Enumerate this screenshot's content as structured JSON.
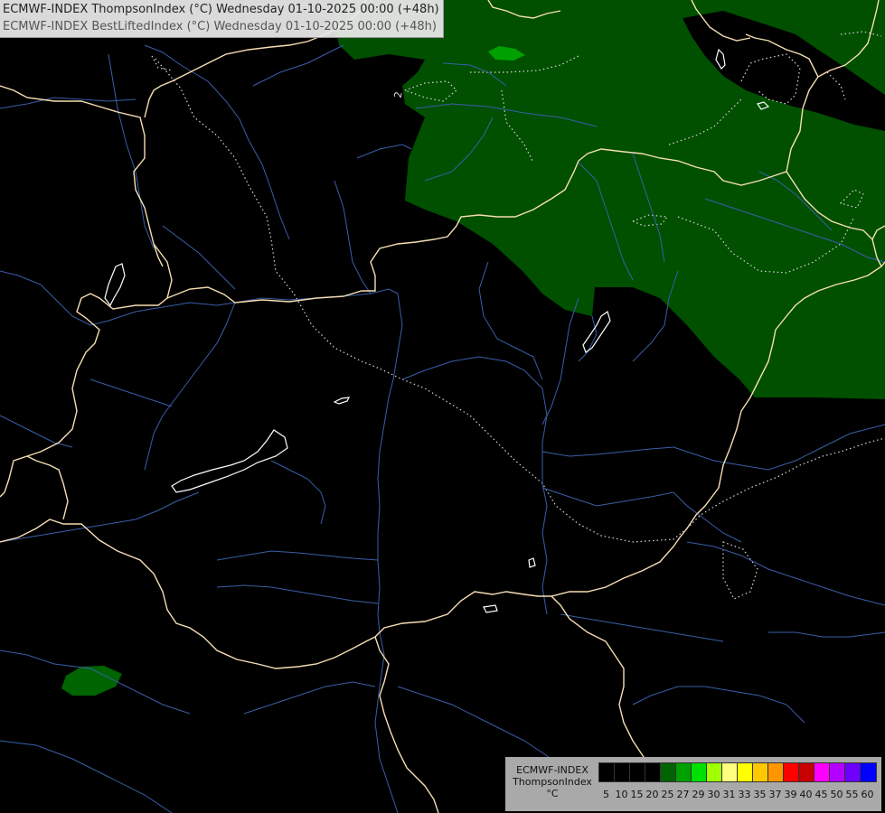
{
  "header": {
    "line1": "ECMWF-INDEX ThompsonIndex (°C) Wednesday 01-10-2025 00:00 (+48h)",
    "line2": "ECMWF-INDEX BestLiftedIndex (°C) Wednesday 01-10-2025 00:00 (+48h)"
  },
  "contour_label": "2",
  "legend": {
    "title_line1": "ECMWF-INDEX",
    "title_line2": "ThompsonIndex",
    "title_line3": "°C",
    "ticks": [
      "5",
      "10",
      "15",
      "20",
      "25",
      "27",
      "29",
      "30",
      "31",
      "33",
      "35",
      "37",
      "39",
      "40",
      "45",
      "50",
      "55",
      "60"
    ],
    "colors": [
      "#000000",
      "#000000",
      "#000000",
      "#000000",
      "#006400",
      "#00a000",
      "#00e000",
      "#a0ff00",
      "#ffff80",
      "#ffff00",
      "#ffc800",
      "#ff9600",
      "#ff0000",
      "#c80000",
      "#ff00ff",
      "#b400ff",
      "#6e00ff",
      "#0000ff"
    ]
  },
  "map_colors": {
    "background": "#000000",
    "thompson_fill": "#005000",
    "thompson_fill_bright": "#00a000",
    "borders": "#f5deb3",
    "rivers": "#3a5ea8",
    "lakes": "#ffffff",
    "lifted_index_contour": "#d8d8d8"
  }
}
